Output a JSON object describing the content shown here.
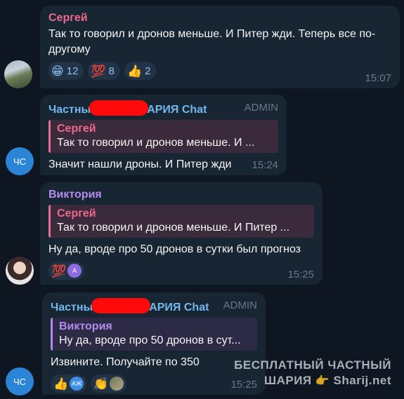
{
  "messages": [
    {
      "sender": "Сергей",
      "text": "Так то говорил и дронов меньше. И Питер жди. Теперь все по-другому",
      "reactions": [
        {
          "emoji": "😁",
          "count": "12"
        },
        {
          "emoji": "💯",
          "count": "8"
        },
        {
          "emoji": "👍",
          "count": "2"
        }
      ],
      "time": "15:07"
    },
    {
      "avatar_initials": "ЧС",
      "sender_prefix": "Частны",
      "sender_suffix": "АРИЯ Chat",
      "role": "ADMIN",
      "reply": {
        "name": "Сергей",
        "text": "Так то говорил и дронов меньше. И ..."
      },
      "text": "Значит нашли дроны. И Питер жди",
      "time": "15:24"
    },
    {
      "sender": "Виктория",
      "reply": {
        "name": "Сергей",
        "text": "Так то говорил и дронов меньше. И Питер ..."
      },
      "text": "Ну да, вроде про 50 дронов в сутки был прогноз",
      "reactions": [
        {
          "emoji": "💯",
          "avatar": "A"
        }
      ],
      "time": "15:25"
    },
    {
      "avatar_initials": "ЧС",
      "sender_prefix": "Частны",
      "sender_suffix": "АРИЯ Chat",
      "role": "ADMIN",
      "reply": {
        "name": "Виктория",
        "text": "Ну да, вроде про 50 дронов в сут..."
      },
      "text": "Извините. Получайте по 350",
      "reactions": [
        {
          "emoji": "👍",
          "avatar": "АЖ"
        },
        {
          "emoji": "👏",
          "avatar": ""
        }
      ],
      "time": "15:25"
    }
  ],
  "watermark": {
    "line1": "БЕСПЛАТНЫЙ ЧАСТНЫЙ",
    "line2_left": "ШАРИЯ",
    "line2_hand": "👉",
    "line2_right": "Sharij.net"
  },
  "colors": {
    "background": "#0e1621",
    "bubble": "#182533",
    "sergey": "#ec6a8b",
    "chat": "#72b8ee",
    "vika": "#b48cf0",
    "redaction": "#ff0a0a"
  }
}
